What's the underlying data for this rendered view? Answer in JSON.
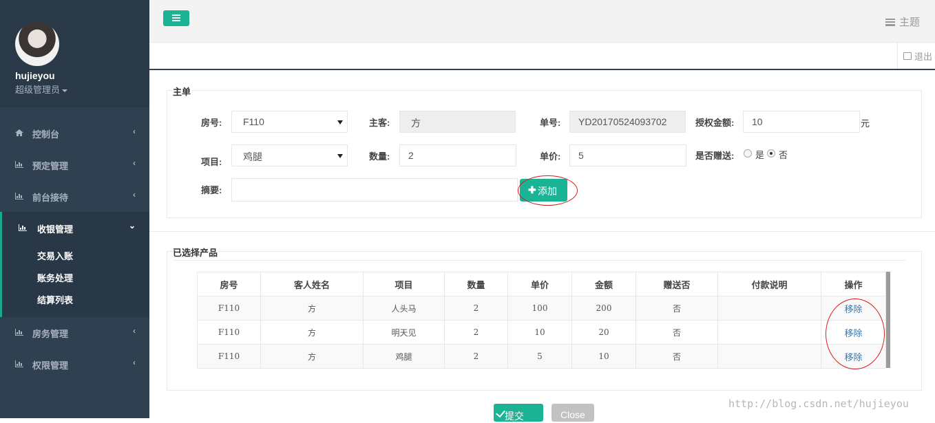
{
  "user": {
    "name": "hujieyou",
    "role": "超级管理员"
  },
  "nav": {
    "items": [
      {
        "label": "控制台"
      },
      {
        "label": "预定管理"
      },
      {
        "label": "前台接待"
      },
      {
        "label": "收银管理"
      },
      {
        "label": "房务管理"
      },
      {
        "label": "权限管理"
      }
    ],
    "sub_items": [
      {
        "label": "交易入账"
      },
      {
        "label": "账务处理"
      },
      {
        "label": "结算列表"
      }
    ]
  },
  "header": {
    "theme_label": "主题",
    "logout_label": "退出"
  },
  "main_order": {
    "title": "主单",
    "room_label": "房号:",
    "room_value": "F110",
    "guest_label": "主客:",
    "guest_value": "方",
    "order_no_label": "单号:",
    "order_no_value": "YD20170524093702",
    "auth_amount_label": "授权金额:",
    "auth_amount_value": "10",
    "auth_amount_unit": "元",
    "item_label": "项目:",
    "item_value": "鸡腿",
    "qty_label": "数量:",
    "qty_value": "2",
    "price_label": "单价:",
    "price_value": "5",
    "gift_label": "是否赠送:",
    "gift_yes": "是",
    "gift_no": "否",
    "gift_selected": "否",
    "summary_label": "摘要:",
    "summary_value": "",
    "add_button": "添加"
  },
  "selected": {
    "title": "已选择产品",
    "columns": [
      "房号",
      "客人姓名",
      "项目",
      "数量",
      "单价",
      "金额",
      "赠送否",
      "付款说明",
      "操作"
    ],
    "rows": [
      {
        "room": "F110",
        "guest": "方",
        "item": "人头马",
        "qty": "2",
        "price": "100",
        "amount": "200",
        "gift": "否",
        "note": "",
        "action": "移除"
      },
      {
        "room": "F110",
        "guest": "方",
        "item": "明天见",
        "qty": "2",
        "price": "10",
        "amount": "20",
        "gift": "否",
        "note": "",
        "action": "移除"
      },
      {
        "room": "F110",
        "guest": "方",
        "item": "鸡腿",
        "qty": "2",
        "price": "5",
        "amount": "10",
        "gift": "否",
        "note": "",
        "action": "移除"
      }
    ]
  },
  "footer": {
    "submit": "提交",
    "close": "Close"
  },
  "watermark": "http://blog.csdn.net/hujieyou",
  "colors": {
    "sidebar": "#2f4050",
    "accent": "#1ab394",
    "annotation": "#d61a1a",
    "link": "#337ab7"
  }
}
